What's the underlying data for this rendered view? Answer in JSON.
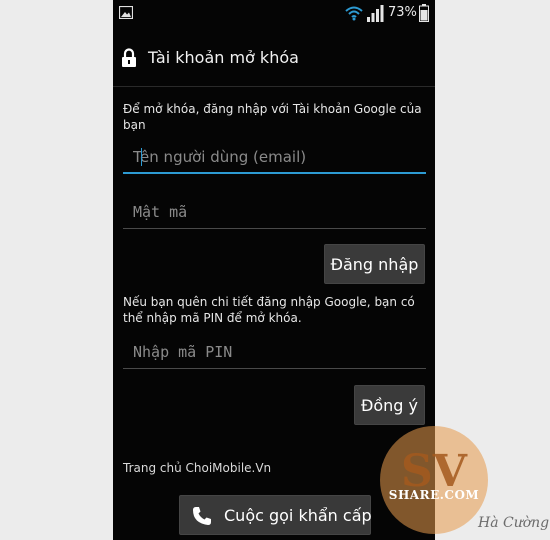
{
  "statusbar": {
    "battery_text": "73%",
    "icons": [
      "gallery-icon",
      "wifi-icon",
      "signal-icon",
      "battery-icon"
    ]
  },
  "header": {
    "title": "Tài khoản mở khóa",
    "icon": "lock-icon"
  },
  "login": {
    "instruction": "Để mở khóa, đăng nhập với Tài khoản Google của bạn",
    "username_placeholder": "Tên người dùng (email)",
    "password_placeholder": "Mật mã",
    "submit_label": "Đăng nhập"
  },
  "pin": {
    "instruction": "Nếu bạn quên chi tiết đăng nhập Google, bạn có thể nhập mã PIN để mở khóa.",
    "pin_placeholder": "Nhập mã PIN",
    "submit_label": "Đồng ý"
  },
  "footer": {
    "link_text": "Trang chủ ChoiMobile.Vn",
    "emergency_label": "Cuộc gọi khẩn cấp",
    "emergency_icon": "phone-icon"
  },
  "watermark": {
    "logo_text": "SV",
    "site_text": "SHARE.COM",
    "signature": "Hà Cường"
  },
  "colors": {
    "accent": "#2d9bd3",
    "background": "#050505",
    "button": "#3a3a3a"
  }
}
